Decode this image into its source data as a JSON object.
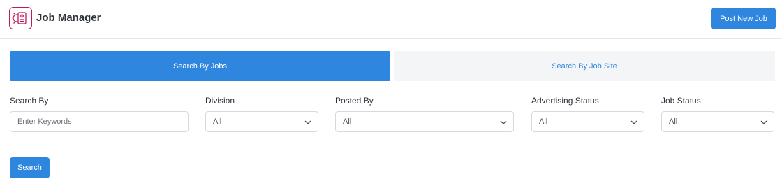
{
  "header": {
    "title": "Job Manager",
    "logo_icon": "job-gear-icon",
    "post_button": "Post New Job"
  },
  "tabs": [
    {
      "label": "Search By Jobs",
      "active": true
    },
    {
      "label": "Search By Job Site",
      "active": false
    }
  ],
  "filters": {
    "search_by": {
      "label": "Search By",
      "placeholder": "Enter Keywords"
    },
    "division": {
      "label": "Division",
      "value": "All"
    },
    "posted_by": {
      "label": "Posted By",
      "value": "All"
    },
    "advertising_status": {
      "label": "Advertising Status",
      "value": "All"
    },
    "job_status": {
      "label": "Job Status",
      "value": "All"
    }
  },
  "search_button": "Search",
  "colors": {
    "accent": "#2e86de",
    "logo": "#c2185b",
    "tab_inactive_bg": "#f4f5f7"
  }
}
